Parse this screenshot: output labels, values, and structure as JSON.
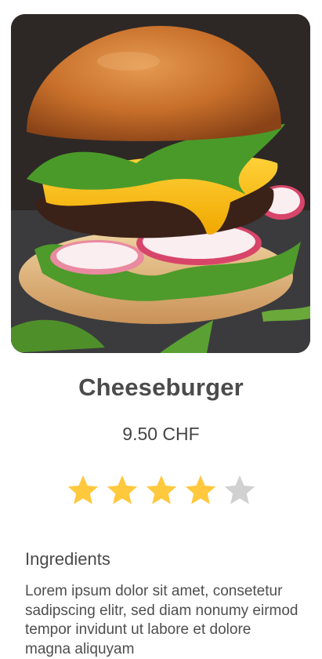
{
  "product": {
    "image_alt": "Cheeseburger photo",
    "name": "Cheeseburger",
    "price": "9.50 CHF",
    "rating": 4,
    "rating_max": 5
  },
  "ingredients": {
    "heading": "Ingredients",
    "text": "Lorem ipsum dolor sit amet, consetetur sadipscing elitr, sed diam nonumy eirmod tempor invidunt ut labore et dolore magna aliquyam"
  },
  "colors": {
    "star_filled": "#FFC83D",
    "star_empty": "#D1D1D1"
  }
}
